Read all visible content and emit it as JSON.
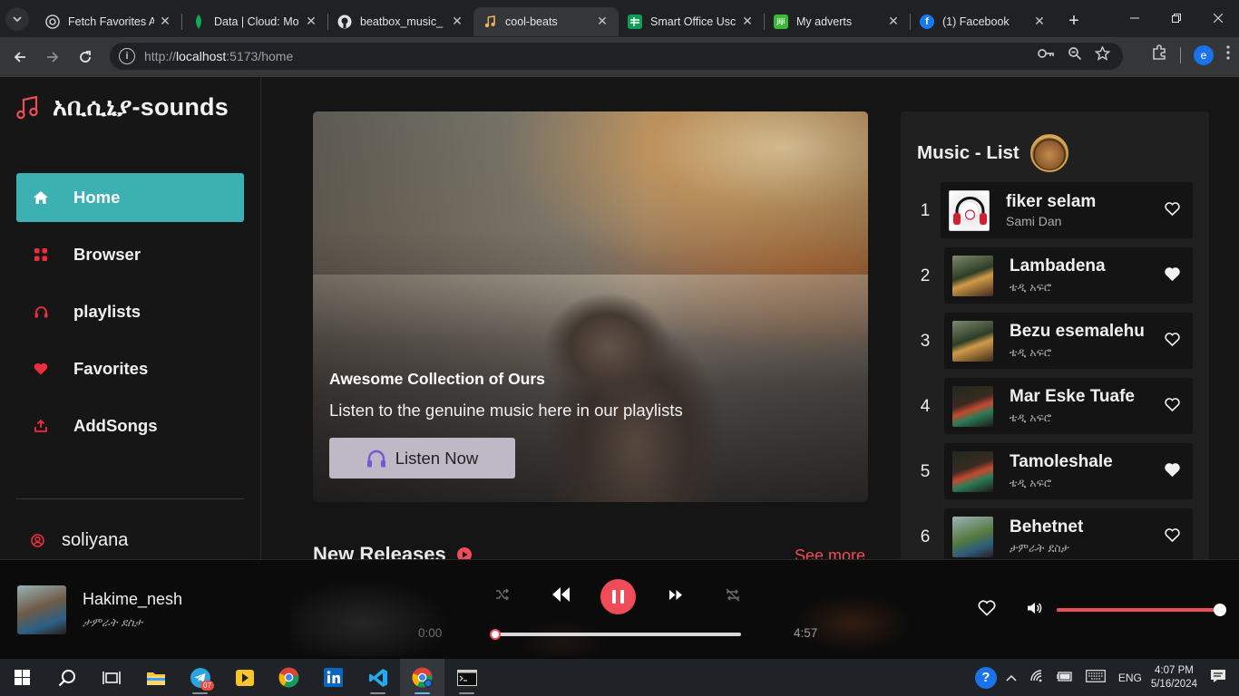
{
  "browser": {
    "tabs": [
      {
        "title": "Fetch Favorites A",
        "icon": "chrome-icon",
        "active": false
      },
      {
        "title": "Data | Cloud: Mo",
        "icon": "mongodb-leaf-icon",
        "active": false
      },
      {
        "title": "beatbox_music_",
        "icon": "github-icon",
        "active": false
      },
      {
        "title": "cool-beats",
        "icon": "music-note-icon",
        "active": true
      },
      {
        "title": "Smart Office Usc",
        "icon": "sheets-icon",
        "active": false
      },
      {
        "title": "My adverts",
        "icon": "jiji-icon",
        "active": false
      },
      {
        "title": "(1) Facebook",
        "icon": "facebook-icon",
        "active": false
      }
    ],
    "url_prefix": "http://",
    "url_host": "localhost",
    "url_rest": ":5173/home",
    "profile_initial": "e"
  },
  "app": {
    "brand_name": "አቢሲኒያ-sounds",
    "nav": [
      {
        "label": "Home",
        "icon": "home-icon",
        "active": true
      },
      {
        "label": "Browser",
        "icon": "grid-icon",
        "active": false
      },
      {
        "label": "playlists",
        "icon": "headphones-icon",
        "active": false
      },
      {
        "label": "Favorites",
        "icon": "heart-icon",
        "active": false
      },
      {
        "label": "AddSongs",
        "icon": "upload-icon",
        "active": false
      }
    ],
    "user_name": "soliyana",
    "accent_color": "#ef4b59",
    "active_color": "#3bb1b1"
  },
  "hero": {
    "title": "Awesome Collection of Ours",
    "subtitle": "Listen to the genuine music here in our playlists",
    "button_label": "Listen Now"
  },
  "releases": {
    "title": "New Releases",
    "see_more": "See more"
  },
  "music_list": {
    "title": "Music - List",
    "items": [
      {
        "num": "1",
        "song": "fiker selam",
        "artist": "Sami Dan",
        "liked": false
      },
      {
        "num": "2",
        "song": "Lambadena",
        "artist": "ቴዲ አፍሮ",
        "liked": true
      },
      {
        "num": "3",
        "song": "Bezu esemalehu",
        "artist": "ቴዲ አፍሮ",
        "liked": false
      },
      {
        "num": "4",
        "song": "Mar Eske Tuafe",
        "artist": "ቴዲ አፍሮ",
        "liked": false
      },
      {
        "num": "5",
        "song": "Tamoleshale",
        "artist": "ቴዲ አፍሮ",
        "liked": true
      },
      {
        "num": "6",
        "song": "Behetnet",
        "artist": "ታምራት ደስታ",
        "liked": false
      }
    ]
  },
  "player": {
    "song": "Hakime_nesh",
    "artist": "ታምራት ደስታ",
    "current_time": "0:00",
    "duration": "4:57",
    "progress": 0.0,
    "volume": 1.0,
    "state": "playing"
  },
  "taskbar": {
    "telegram_badge": "07",
    "lang": "ENG",
    "time": "4:07 PM",
    "date": "5/16/2024"
  }
}
